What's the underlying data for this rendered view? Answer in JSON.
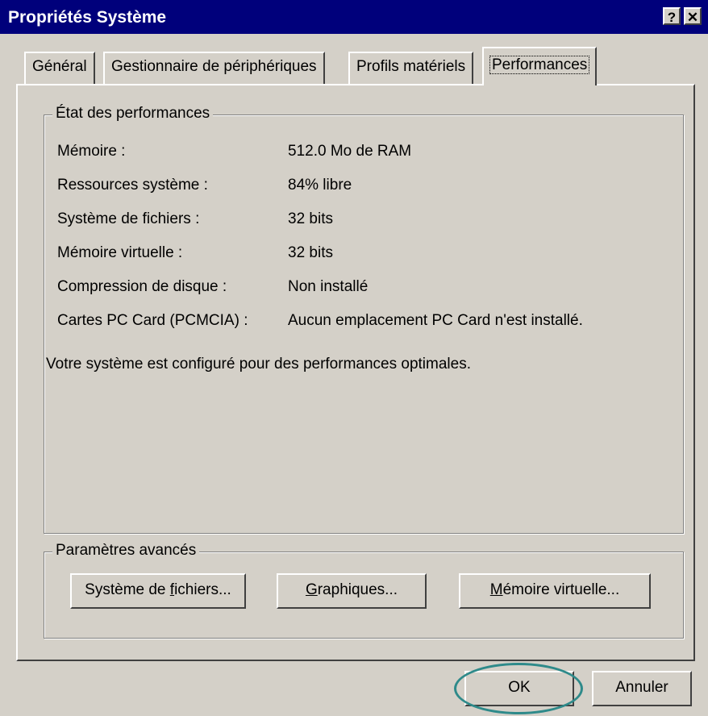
{
  "window": {
    "title": "Propriétés Système",
    "help_label": "?",
    "close_label": "✕"
  },
  "tabs": [
    {
      "label": "Général"
    },
    {
      "label": "Gestionnaire de périphériques"
    },
    {
      "label": "Profils matériels"
    },
    {
      "label": "Performances",
      "active": true
    }
  ],
  "status_group": {
    "title": "État des performances",
    "rows": [
      {
        "label": "Mémoire :",
        "value": "512.0 Mo de RAM"
      },
      {
        "label": "Ressources système :",
        "value": "84% libre"
      },
      {
        "label": "Système de fichiers :",
        "value": "32 bits"
      },
      {
        "label": "Mémoire virtuelle :",
        "value": "32 bits"
      },
      {
        "label": "Compression de disque :",
        "value": "Non installé"
      },
      {
        "label": "Cartes PC Card (PCMCIA) :",
        "value": "Aucun emplacement PC Card n'est installé."
      }
    ],
    "message": "Votre système est configuré pour des performances optimales."
  },
  "advanced_group": {
    "title": "Paramètres avancés",
    "buttons": {
      "filesystem": {
        "pre": "Système de ",
        "key": "f",
        "post": "ichiers..."
      },
      "graphics": {
        "pre": "",
        "key": "G",
        "post": "raphiques..."
      },
      "virtual_memory": {
        "pre": "",
        "key": "M",
        "post": "émoire virtuelle..."
      }
    }
  },
  "footer": {
    "ok_label": "OK",
    "cancel_label": "Annuler"
  }
}
